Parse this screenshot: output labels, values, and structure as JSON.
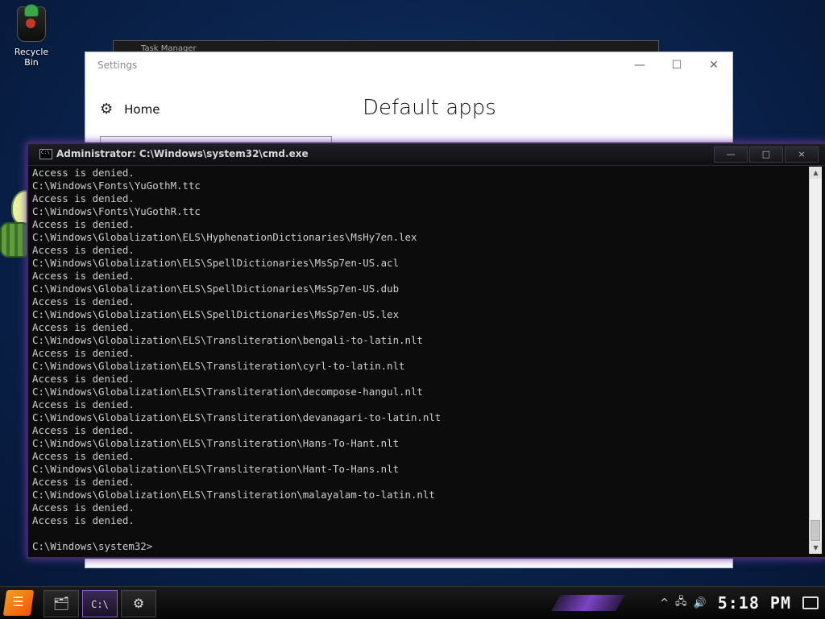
{
  "desktop": {
    "recycle_bin_label": "Recycle Bin"
  },
  "task_manager": {
    "title": "Task Manager"
  },
  "settings": {
    "window_title": "Settings",
    "minimize": "—",
    "maximize": "☐",
    "close": "✕",
    "home_label": "Home",
    "heading": "Default apps"
  },
  "cmd": {
    "title": "Administrator: C:\\Windows\\system32\\cmd.exe",
    "minimize": "—",
    "maximize": "□",
    "close": "×",
    "lines": [
      "Access is denied.",
      "C:\\Windows\\Fonts\\YuGothM.ttc",
      "Access is denied.",
      "C:\\Windows\\Fonts\\YuGothR.ttc",
      "Access is denied.",
      "C:\\Windows\\Globalization\\ELS\\HyphenationDictionaries\\MsHy7en.lex",
      "Access is denied.",
      "C:\\Windows\\Globalization\\ELS\\SpellDictionaries\\MsSp7en-US.acl",
      "Access is denied.",
      "C:\\Windows\\Globalization\\ELS\\SpellDictionaries\\MsSp7en-US.dub",
      "Access is denied.",
      "C:\\Windows\\Globalization\\ELS\\SpellDictionaries\\MsSp7en-US.lex",
      "Access is denied.",
      "C:\\Windows\\Globalization\\ELS\\Transliteration\\bengali-to-latin.nlt",
      "Access is denied.",
      "C:\\Windows\\Globalization\\ELS\\Transliteration\\cyrl-to-latin.nlt",
      "Access is denied.",
      "C:\\Windows\\Globalization\\ELS\\Transliteration\\decompose-hangul.nlt",
      "Access is denied.",
      "C:\\Windows\\Globalization\\ELS\\Transliteration\\devanagari-to-latin.nlt",
      "Access is denied.",
      "C:\\Windows\\Globalization\\ELS\\Transliteration\\Hans-To-Hant.nlt",
      "Access is denied.",
      "C:\\Windows\\Globalization\\ELS\\Transliteration\\Hant-To-Hans.nlt",
      "Access is denied.",
      "C:\\Windows\\Globalization\\ELS\\Transliteration\\malayalam-to-latin.nlt",
      "Access is denied.",
      "Access is denied.",
      "",
      "C:\\Windows\\system32>"
    ]
  },
  "taskbar": {
    "clock": "5:18 PM",
    "icons": [
      "start-icon",
      "file-explorer-icon",
      "cmd-icon",
      "settings-gear-icon"
    ]
  },
  "colors": {
    "accent": "#7a45c4",
    "cmd_bg": "#0c0c0c",
    "cmd_text": "#cfcfcf"
  }
}
